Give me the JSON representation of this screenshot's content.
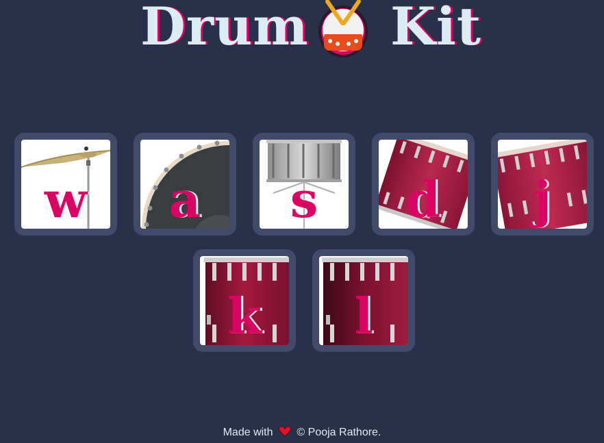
{
  "header": {
    "title_left": "Drum",
    "title_right": "Kit",
    "logo_icon": "drum-icon"
  },
  "keys": [
    {
      "letter": "w",
      "instrument": "cymbal-icon"
    },
    {
      "letter": "a",
      "instrument": "bass-drum-icon"
    },
    {
      "letter": "s",
      "instrument": "snare-drum-icon"
    },
    {
      "letter": "d",
      "instrument": "tom-drum-icon"
    },
    {
      "letter": "j",
      "instrument": "tom-drum-icon"
    },
    {
      "letter": "k",
      "instrument": "floor-tom-icon"
    },
    {
      "letter": "l",
      "instrument": "floor-tom-icon"
    }
  ],
  "footer": {
    "made_with": "Made with",
    "heart_icon": "heart-icon",
    "credit": "© Pooja Rathore."
  },
  "colors": {
    "background": "#283149",
    "key_frame": "#404b69",
    "accent": "#da0463",
    "text": "#dbedf3",
    "drum_red": "#a3183c"
  }
}
